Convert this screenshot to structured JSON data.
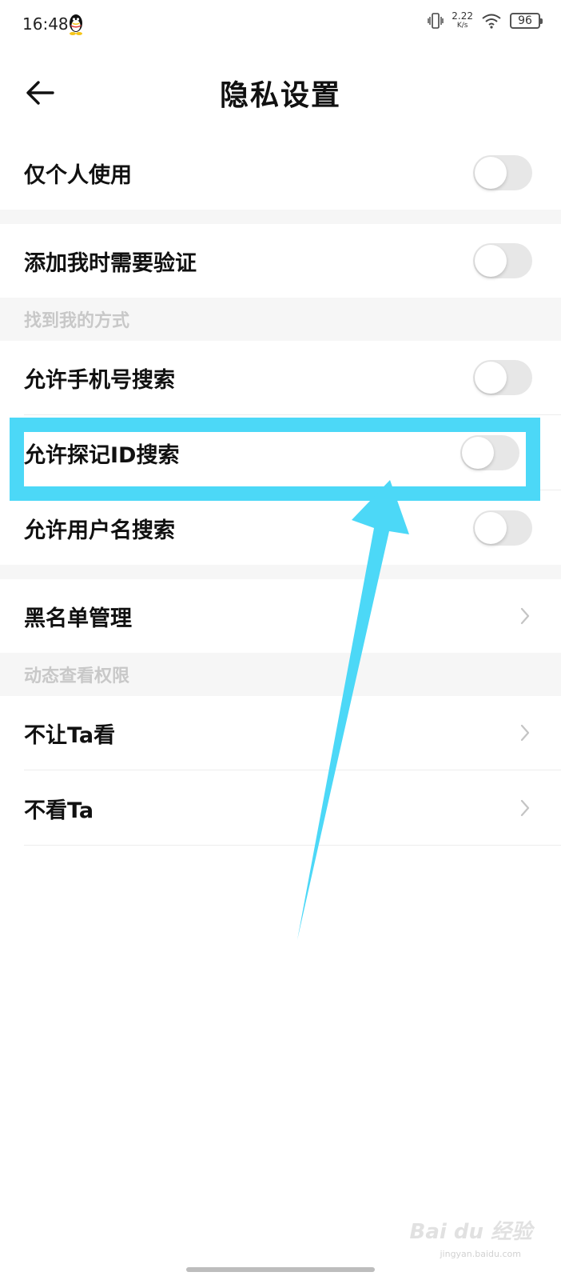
{
  "status_bar": {
    "time": "16:48",
    "net_speed_value": "2.22",
    "net_speed_unit": "K/s",
    "battery_level": "96"
  },
  "header": {
    "title": "隐私设置"
  },
  "rows": {
    "personal_only": {
      "label": "仅个人使用",
      "toggle_on": false
    },
    "verify_add": {
      "label": "添加我时需要验证",
      "toggle_on": false
    },
    "section_find_me": "找到我的方式",
    "phone_search": {
      "label": "允许手机号搜索",
      "toggle_on": false
    },
    "id_search": {
      "label": "允许探记ID搜索",
      "toggle_on": false
    },
    "username_search": {
      "label": "允许用户名搜索",
      "toggle_on": false
    },
    "blacklist": {
      "label": "黑名单管理"
    },
    "section_feed_permission": "动态查看权限",
    "hide_from": {
      "label": "不让Ta看"
    },
    "dont_see": {
      "label": "不看Ta"
    }
  },
  "watermark": {
    "text": "Bai du 经验",
    "sub": "jingyan.baidu.com"
  },
  "icons": {
    "back": "back-arrow-icon",
    "chevron": "chevron-right-icon",
    "vibrate": "vibrate-icon",
    "wifi": "wifi-icon",
    "battery": "battery-icon",
    "qq": "qq-penguin-icon"
  },
  "colors": {
    "highlight": "#4cd8f7",
    "toggle_off_track": "#e7e7e7",
    "section_bg": "#f6f6f6",
    "section_text": "#c8c8c8"
  }
}
